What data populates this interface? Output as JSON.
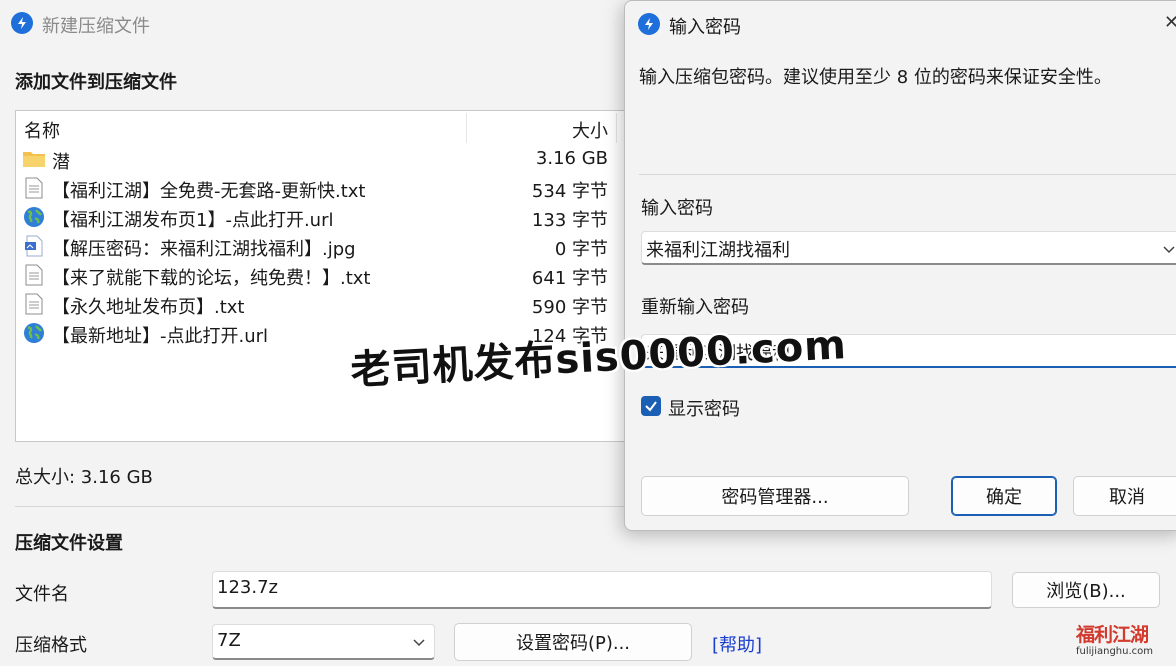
{
  "main_window": {
    "title": "新建压缩文件",
    "add_files_heading": "添加文件到压缩文件",
    "columns": {
      "name": "名称",
      "size": "大小"
    },
    "files": [
      {
        "name": "潜",
        "size": "3.16 GB",
        "icon": "folder-icon"
      },
      {
        "name": "【福利江湖】全免费-无套路-更新快.txt",
        "size": "534 字节",
        "icon": "text-file-icon"
      },
      {
        "name": "【福利江湖发布页1】-点此打开.url",
        "size": "133 字节",
        "icon": "globe-icon"
      },
      {
        "name": "【解压密码：来福利江湖找福利】.jpg",
        "size": "0 字节",
        "icon": "image-file-icon"
      },
      {
        "name": "【来了就能下载的论坛，纯免费！】.txt",
        "size": "641 字节",
        "icon": "text-file-icon"
      },
      {
        "name": "【永久地址发布页】.txt",
        "size": "590 字节",
        "icon": "text-file-icon"
      },
      {
        "name": "【最新地址】-点此打开.url",
        "size": "124 字节",
        "icon": "globe-icon"
      }
    ],
    "total_size": "总大小: 3.16 GB",
    "settings_heading": "压缩文件设置",
    "filename_label": "文件名",
    "filename_value": "123.7z",
    "browse_button": "浏览(B)...",
    "format_label": "压缩格式",
    "format_value": "7Z",
    "set_password_button": "设置密码(P)...",
    "help_link": "[帮助]"
  },
  "password_dialog": {
    "title": "输入密码",
    "message": "输入压缩包密码。建议使用至少 8 位的密码来保证安全性。",
    "password_label": "输入密码",
    "password_value": "来福利江湖找福利",
    "reenter_label": "重新输入密码",
    "reenter_value": "来福利江湖找福利",
    "show_password_label": "显示密码",
    "show_password_checked": true,
    "manager_button": "密码管理器...",
    "ok_button": "确定",
    "cancel_button": "取消"
  },
  "overlay": {
    "watermark": "老司机发布sis0000.com",
    "logo_text": "福利江湖",
    "logo_url": "fulijianghu.com"
  },
  "colors": {
    "accent": "#1a5fb4",
    "link": "#1a3fcc",
    "app_icon": "#1e6fd9"
  }
}
